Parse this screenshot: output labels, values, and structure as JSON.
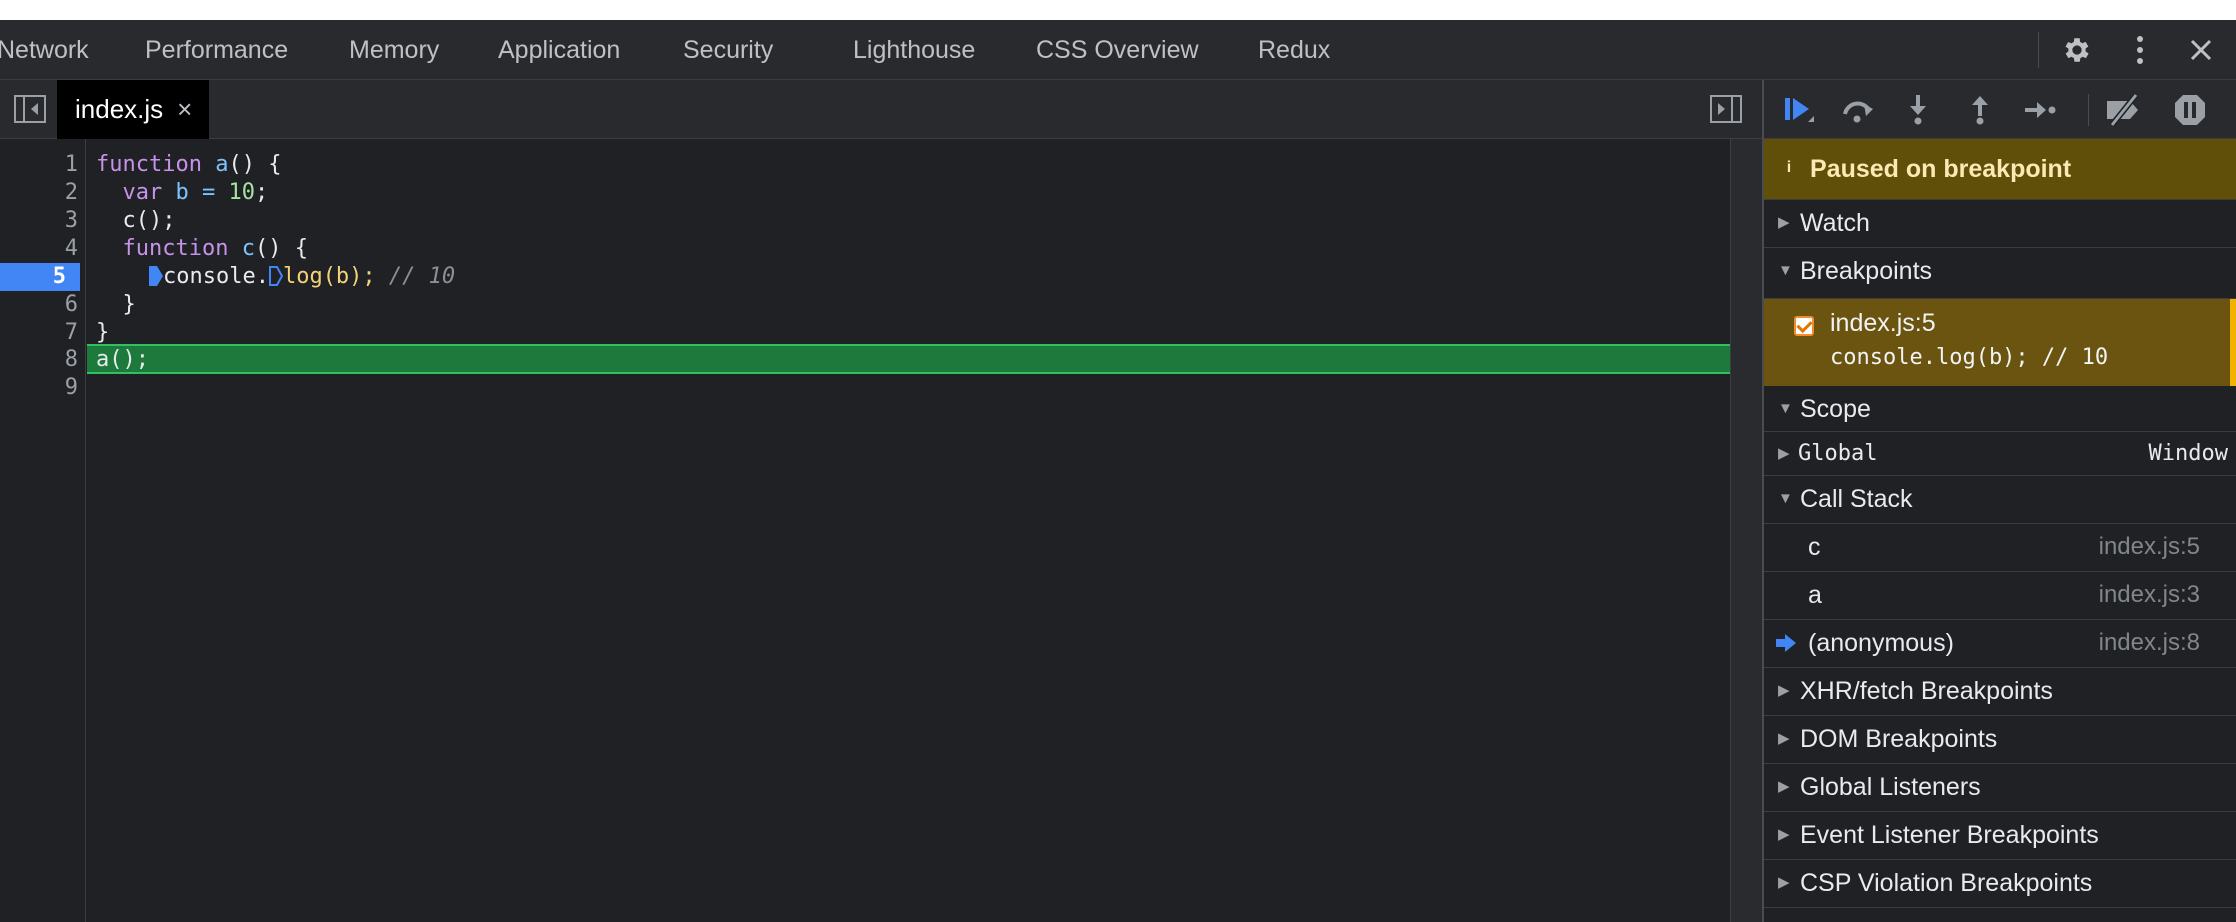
{
  "window": {
    "tabs": [
      "Network",
      "Performance",
      "Memory",
      "Application",
      "Security",
      "Lighthouse",
      "CSS Overview",
      "Redux"
    ],
    "icons": [
      "gear-icon",
      "more-vertical-icon",
      "close-icon"
    ]
  },
  "source_tab": {
    "filename": "index.js",
    "close_glyph": "×"
  },
  "editor": {
    "line_numbers": [
      "1",
      "2",
      "3",
      "4",
      "5",
      "6",
      "7",
      "8",
      "9"
    ],
    "paused_line": "5",
    "execution_line": "8",
    "lines": {
      "l1": {
        "kw": "function",
        "fn": "a",
        "rest": "() {"
      },
      "l2": {
        "pre": "  ",
        "kw": "var",
        "name": " b = ",
        "num": "10",
        "rest": ";"
      },
      "l3": {
        "text": "  c();"
      },
      "l4": {
        "pre": "  ",
        "kw": "function",
        "fn": "c",
        "rest": "() {"
      },
      "l5": {
        "a": "console.",
        "b": "log(b); ",
        "comment": "// 10"
      },
      "l6": {
        "text": "  }"
      },
      "l7": {
        "text": "}"
      },
      "l8": {
        "text": "a();"
      },
      "l9": {
        "text": ""
      }
    }
  },
  "debugger": {
    "controls": [
      "resume-icon",
      "step-over-icon",
      "step-into-icon",
      "step-out-icon",
      "step-icon",
      "deactivate-breakpoints-icon",
      "pause-on-exceptions-icon"
    ],
    "paused_message": "Paused on breakpoint",
    "info_glyph": "i",
    "sections": {
      "watch": "Watch",
      "breakpoints": "Breakpoints",
      "scope": "Scope",
      "call_stack": "Call Stack",
      "xhr": "XHR/fetch Breakpoints",
      "dom": "DOM Breakpoints",
      "global_listeners": "Global Listeners",
      "event_listeners": "Event Listener Breakpoints",
      "csp": "CSP Violation Breakpoints"
    },
    "breakpoint": {
      "location": "index.js:5",
      "code": "console.log(b); // 10",
      "checked": true
    },
    "scope_global": {
      "name": "Global",
      "value": "Window"
    },
    "call_stack": [
      {
        "name": "c",
        "location": "index.js:5"
      },
      {
        "name": "a",
        "location": "index.js:3"
      },
      {
        "name": "(anonymous)",
        "location": "index.js:8"
      }
    ]
  },
  "colors": {
    "accent": "#4285f4",
    "paused_banner": "#5f4f08",
    "breakpoint_row": "#6a5410",
    "execution_line": "#1e7a3c"
  }
}
